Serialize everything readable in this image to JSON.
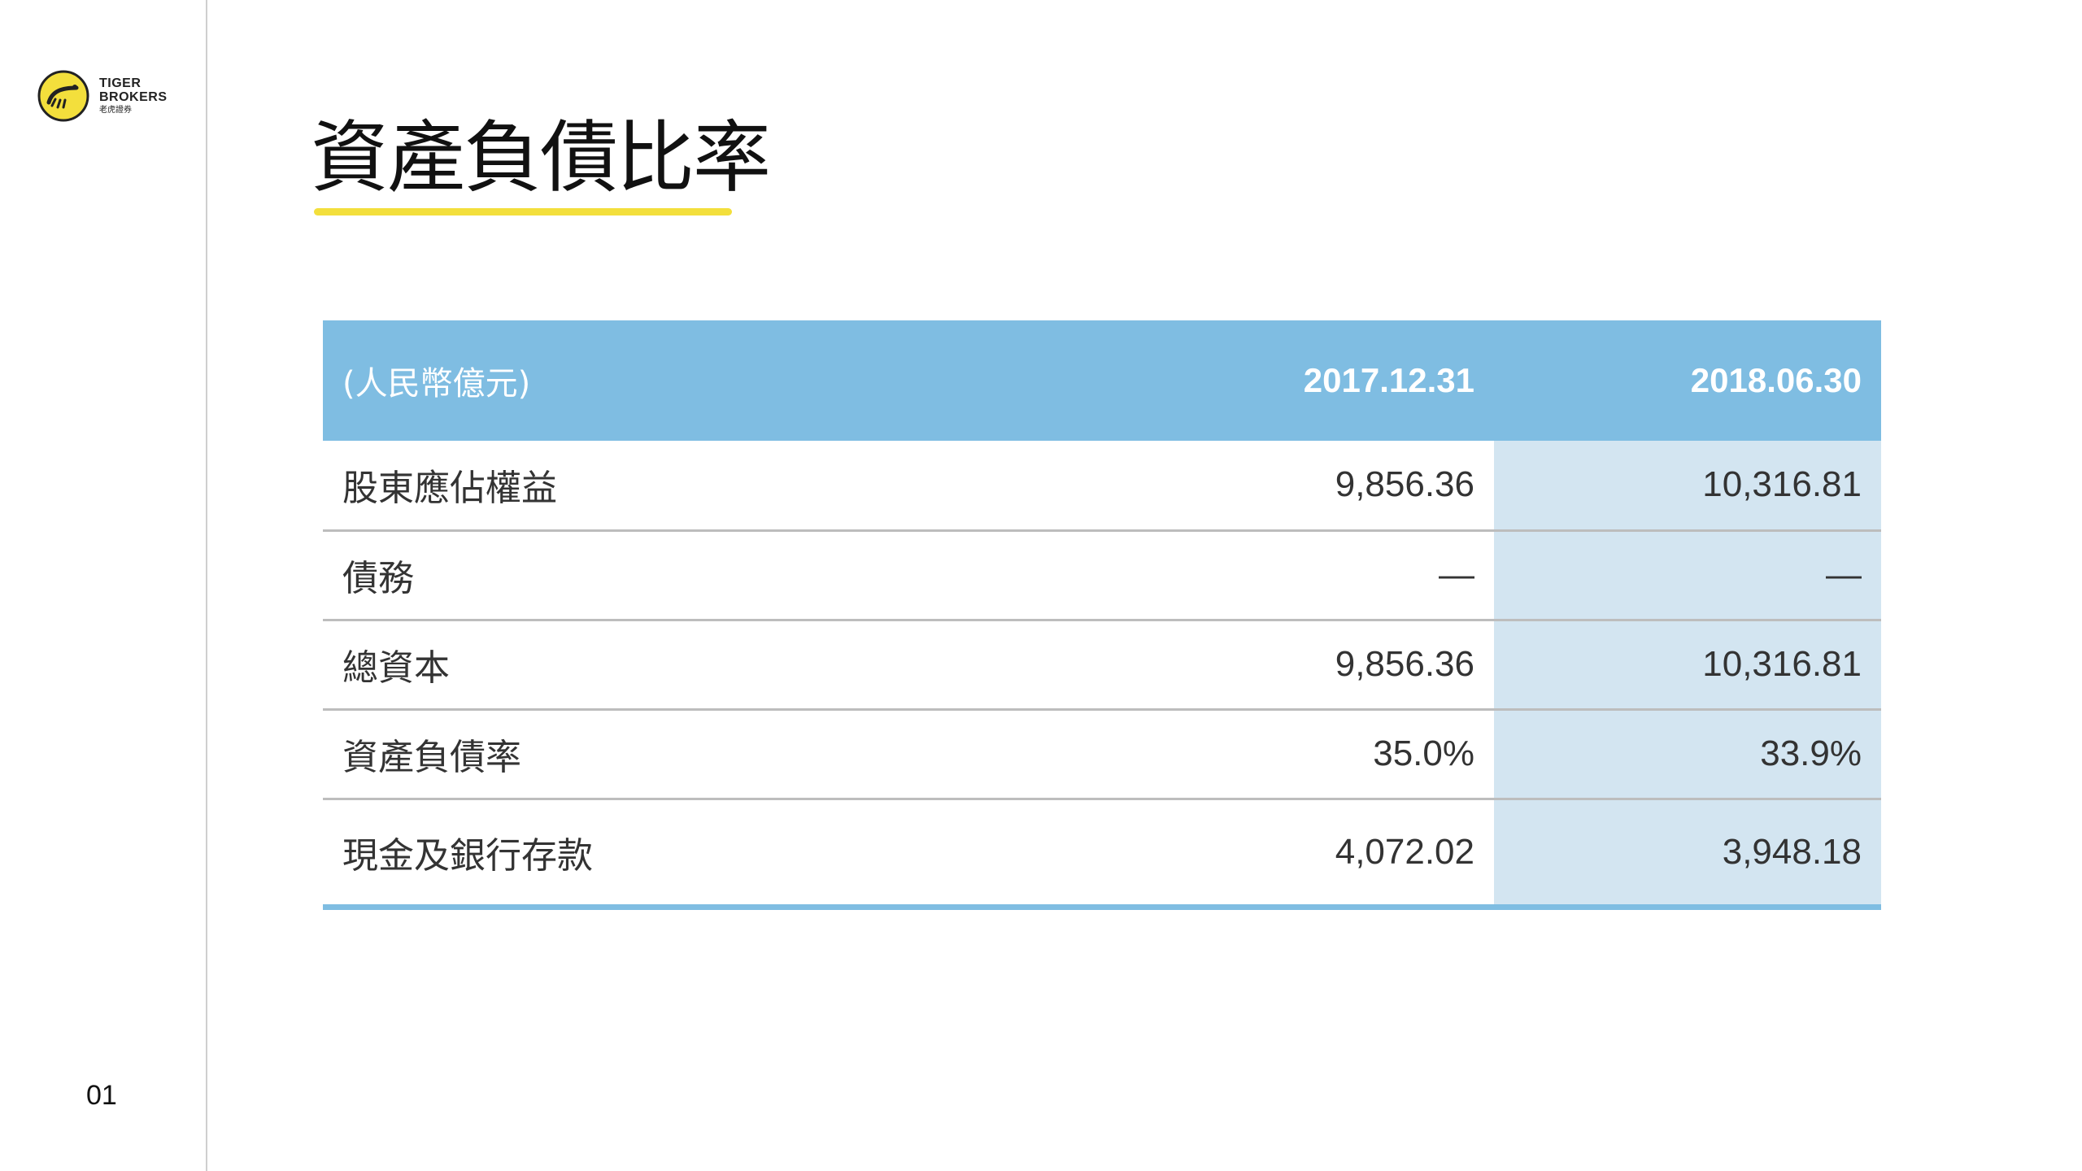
{
  "logo": {
    "line1": "TIGER",
    "line2": "BROKERS",
    "line3": "老虎證券",
    "brand_color": "#f3df3c"
  },
  "page": {
    "number": "01"
  },
  "title": "資產負債比率",
  "colors": {
    "header_bg": "#7fbde2",
    "highlight_column": "#d3e5f1",
    "title_underline": "#f3df3c"
  },
  "table": {
    "headers": [
      "(人民幣億元)",
      "2017.12.31",
      "2018.06.30"
    ],
    "rows": [
      [
        "股東應佔權益",
        "9,856.36",
        "10,316.81"
      ],
      [
        "債務",
        "—",
        "—"
      ],
      [
        "總資本",
        "9,856.36",
        "10,316.81"
      ],
      [
        "資產負債率",
        "35.0%",
        "33.9%"
      ],
      [
        "現金及銀行存款",
        "4,072.02",
        "3,948.18"
      ]
    ]
  }
}
